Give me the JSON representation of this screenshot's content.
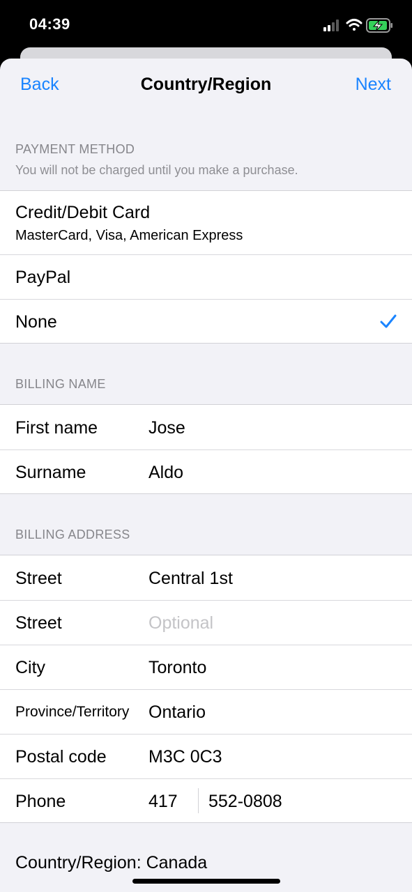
{
  "status_bar": {
    "time": "04:39",
    "icons": [
      "signal-icon",
      "wifi-icon",
      "battery-charging-icon"
    ]
  },
  "nav": {
    "back": "Back",
    "title": "Country/Region",
    "next": "Next"
  },
  "payment": {
    "header": "PAYMENT METHOD",
    "subheader": "You will not be charged until you make a purchase.",
    "options": [
      {
        "label": "Credit/Debit Card",
        "detail": "MasterCard, Visa, American Express",
        "selected": false
      },
      {
        "label": "PayPal",
        "selected": false
      },
      {
        "label": "None",
        "selected": true
      }
    ]
  },
  "billing_name": {
    "header": "BILLING NAME",
    "fields": [
      {
        "label": "First name",
        "value": "Jose"
      },
      {
        "label": "Surname",
        "value": "Aldo"
      }
    ]
  },
  "billing_address": {
    "header": "BILLING ADDRESS",
    "fields": [
      {
        "label": "Street",
        "value": "Central 1st"
      },
      {
        "label": "Street",
        "placeholder": "Optional"
      },
      {
        "label": "City",
        "value": "Toronto"
      },
      {
        "label": "Province/Territory",
        "value": "Ontario"
      },
      {
        "label": "Postal code",
        "value": "M3C 0C3"
      }
    ],
    "phone": {
      "label": "Phone",
      "area_code": "417",
      "number": "552-0808"
    }
  },
  "country": {
    "text": "Country/Region: Canada"
  },
  "colors": {
    "accent": "#1a84ff",
    "background": "#f2f2f7",
    "separator": "#d1d1d6"
  }
}
